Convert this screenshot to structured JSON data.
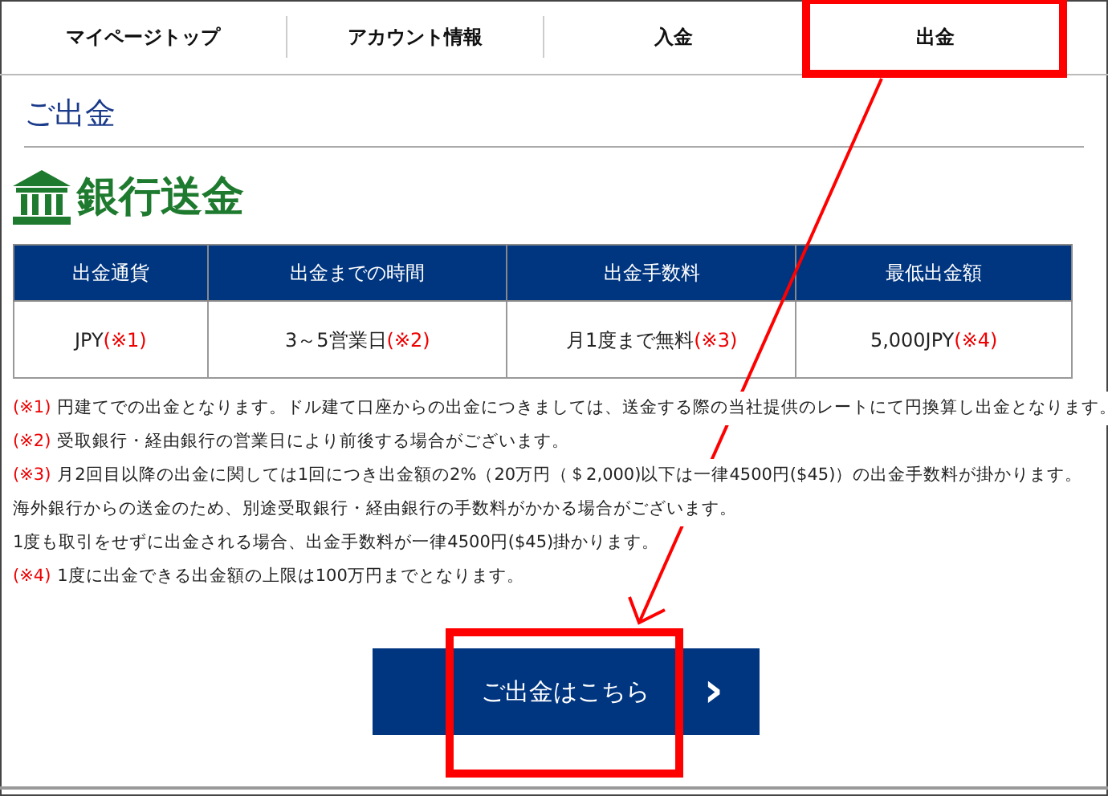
{
  "tabs": [
    {
      "label": "マイページトップ"
    },
    {
      "label": "アカウント情報"
    },
    {
      "label": "入金"
    },
    {
      "label": "出金"
    }
  ],
  "page_title": "ご出金",
  "section_title": "銀行送金",
  "table": {
    "columns": [
      "出金通貨",
      "出金までの時間",
      "出金手数料",
      "最低出金額"
    ],
    "rows": [
      [
        {
          "value": "JPY",
          "note": "(※1)"
        },
        {
          "value": "3～5営業日",
          "note": "(※2)"
        },
        {
          "value": "月1度まで無料",
          "note": "(※3)"
        },
        {
          "value": "5,000JPY",
          "note": "(※4)"
        }
      ]
    ]
  },
  "notes": [
    {
      "mark": "(※1)",
      "text": "円建てでの出金となります。ドル建て口座からの出金につきましては、送金する際の当社提供のレートにて円換算し出金となります。"
    },
    {
      "mark": "(※2)",
      "text": "受取銀行・経由銀行の営業日により前後する場合がございます。"
    },
    {
      "mark": "(※3)",
      "text": "月2回目以降の出金に関しては1回につき出金額の2%（20万円（＄2,000)以下は一律4500円($45)）の出金手数料が掛かります。"
    },
    {
      "text": "海外銀行からの送金のため、別途受取銀行・経由銀行の手数料がかかる場合がございます。"
    },
    {
      "text": "1度も取引をせずに出金される場合、出金手数料が一律4500円($45)掛かります。"
    },
    {
      "mark": "(※4)",
      "text": "1度に出金できる出金額の上限は100万円までとなります。"
    }
  ],
  "button": {
    "label": "ご出金はこちら",
    "arrow": "›"
  }
}
